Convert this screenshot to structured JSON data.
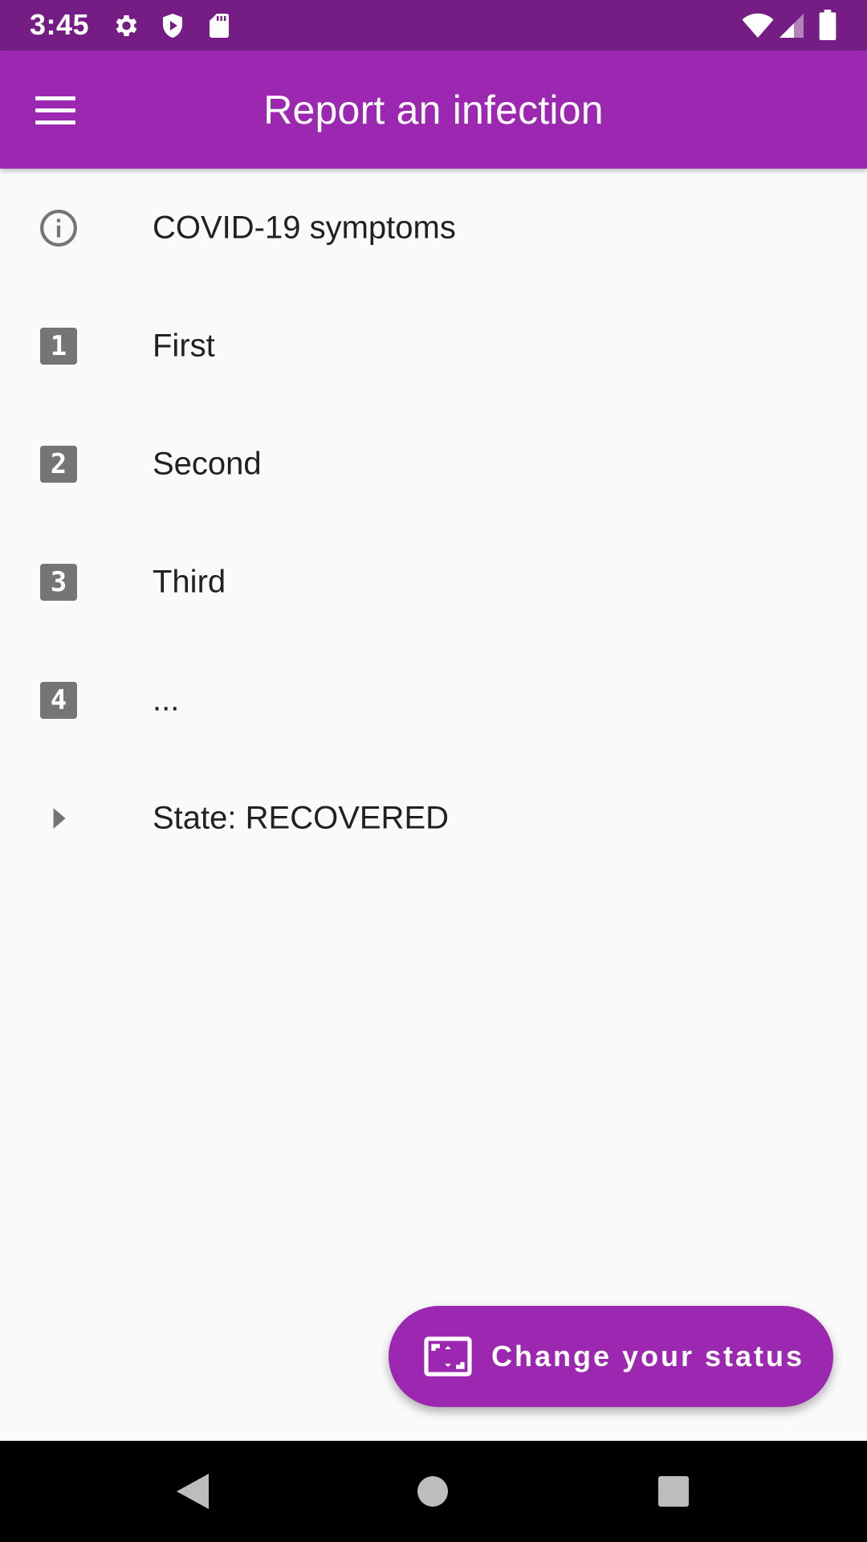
{
  "status_bar": {
    "time": "3:45",
    "icons": [
      "settings-icon",
      "shield-icon",
      "sd-card-icon",
      "wifi-icon",
      "signal-icon",
      "battery-icon"
    ]
  },
  "app_bar": {
    "title": "Report an infection",
    "menu_icon": "menu-icon"
  },
  "list": {
    "items": [
      {
        "icon": "info-icon",
        "label": "COVID-19 symptoms"
      },
      {
        "icon": "number-1-icon",
        "badge": "1",
        "label": "First"
      },
      {
        "icon": "number-2-icon",
        "badge": "2",
        "label": "Second"
      },
      {
        "icon": "number-3-icon",
        "badge": "3",
        "label": "Third"
      },
      {
        "icon": "number-4-icon",
        "badge": "4",
        "label": "..."
      },
      {
        "icon": "arrow-right-icon",
        "label": "State: RECOVERED"
      }
    ]
  },
  "fab": {
    "icon": "aspect-ratio-icon",
    "label": "Change your status"
  },
  "colors": {
    "status_bar": "#751d85",
    "app_bar": "#9c27b0",
    "fab": "#9c27b0",
    "icon_grey": "#757575",
    "background": "#fafafa"
  },
  "nav_bar": {
    "icons": [
      "back-icon",
      "home-icon",
      "recents-icon"
    ]
  }
}
